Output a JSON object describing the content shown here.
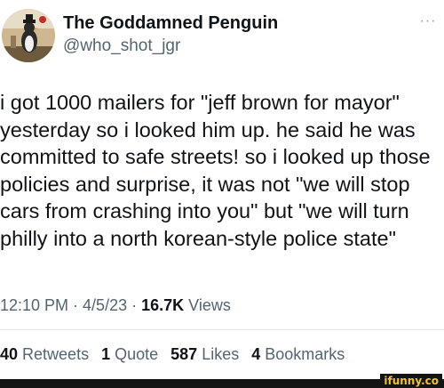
{
  "author": {
    "display_name": "The Goddamned Penguin",
    "handle": "@who_shot_jgr"
  },
  "header": {
    "more_icon": "more-horizontal-icon",
    "more_glyph": "···"
  },
  "tweet": {
    "text": "i got 1000 mailers for \"jeff brown for mayor\"\nyesterday so i looked him up. he said he was\ncommitted to safe streets! so i looked up those\npolicies and surprise, it was not \"we will stop\ncars from crashing into you\" but \"we will turn\nphilly into a north korean-style police state\""
  },
  "meta": {
    "time": "12:10 PM",
    "separator": "·",
    "date": "4/5/23",
    "views_count": "16.7K",
    "views_label": "Views"
  },
  "stats": {
    "retweets_count": "40",
    "retweets_label": "Retweets",
    "quotes_count": "1",
    "quotes_label": "Quote",
    "likes_count": "587",
    "likes_label": "Likes",
    "bookmarks_count": "4",
    "bookmarks_label": "Bookmarks"
  },
  "watermark": {
    "text": "ifunny.co"
  },
  "colors": {
    "text_primary": "#0f1419",
    "text_secondary": "#536471",
    "watermark": "#f4c22b"
  }
}
